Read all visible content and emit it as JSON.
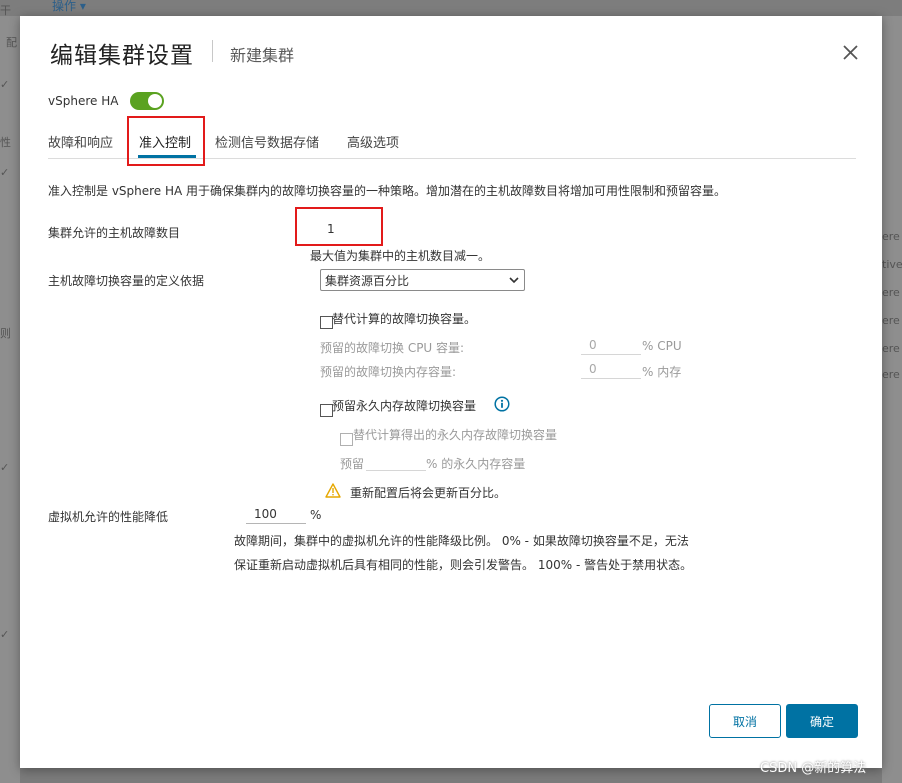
{
  "background": {
    "ops_menu": "操作 ▾",
    "left_frags": [
      "干",
      "配",
      "✓",
      "性",
      "✓",
      "则",
      "✓",
      "✓"
    ],
    "right_frags": [
      "ere",
      "tive",
      "ere",
      "ere",
      "ere",
      "ere"
    ]
  },
  "dialog": {
    "title": "编辑集群设置",
    "subtitle": "新建集群",
    "ha_label": "vSphere HA",
    "ha_enabled": true,
    "tabs": [
      "故障和响应",
      "准入控制",
      "检测信号数据存储",
      "高级选项"
    ],
    "active_tab": "准入控制",
    "description": "准入控制是 vSphere HA 用于确保集群内的故障切换容量的一种策略。增加潜在的主机故障数目将增加可用性限制和预留容量。",
    "host_failures_label": "集群允许的主机故障数目",
    "host_failures_value": "1",
    "host_failures_hint": "最大值为集群中的主机数目减一。",
    "capacity_def_label": "主机故障切换容量的定义依据",
    "capacity_def_value": "集群资源百分比",
    "override_label": "替代计算的故障切换容量。",
    "cpu_reserve_label": "预留的故障切换 CPU 容量:",
    "cpu_reserve_value": "0",
    "cpu_unit": "% CPU",
    "mem_reserve_label": "预留的故障切换内存容量:",
    "mem_reserve_value": "0",
    "mem_unit": "% 内存",
    "pmem_reserve_label": "预留永久内存故障切换容量",
    "pmem_override_label": "替代计算得出的永久内存故障切换容量",
    "pmem_prefix": "预留",
    "pmem_value": "",
    "pmem_suffix": "% 的永久内存容量",
    "warning_text": "重新配置后将会更新百分比。",
    "perf_label": "虚拟机允许的性能降低",
    "perf_value": "100",
    "perf_unit": "%",
    "perf_desc_1": "故障期间，集群中的虚拟机允许的性能降级比例。 0% - 如果故障切换容量不足，无法",
    "perf_desc_2": "保证重新启动虚拟机后具有相同的性能，则会引发警告。 100% - 警告处于禁用状态。",
    "cancel_label": "取消",
    "ok_label": "确定"
  },
  "watermark": "CSDN @新的算法",
  "colors": {
    "accent": "#0072a3",
    "toggle_on": "#5aa220",
    "highlight_box": "#e21a1a",
    "warning": "#e6a700"
  }
}
